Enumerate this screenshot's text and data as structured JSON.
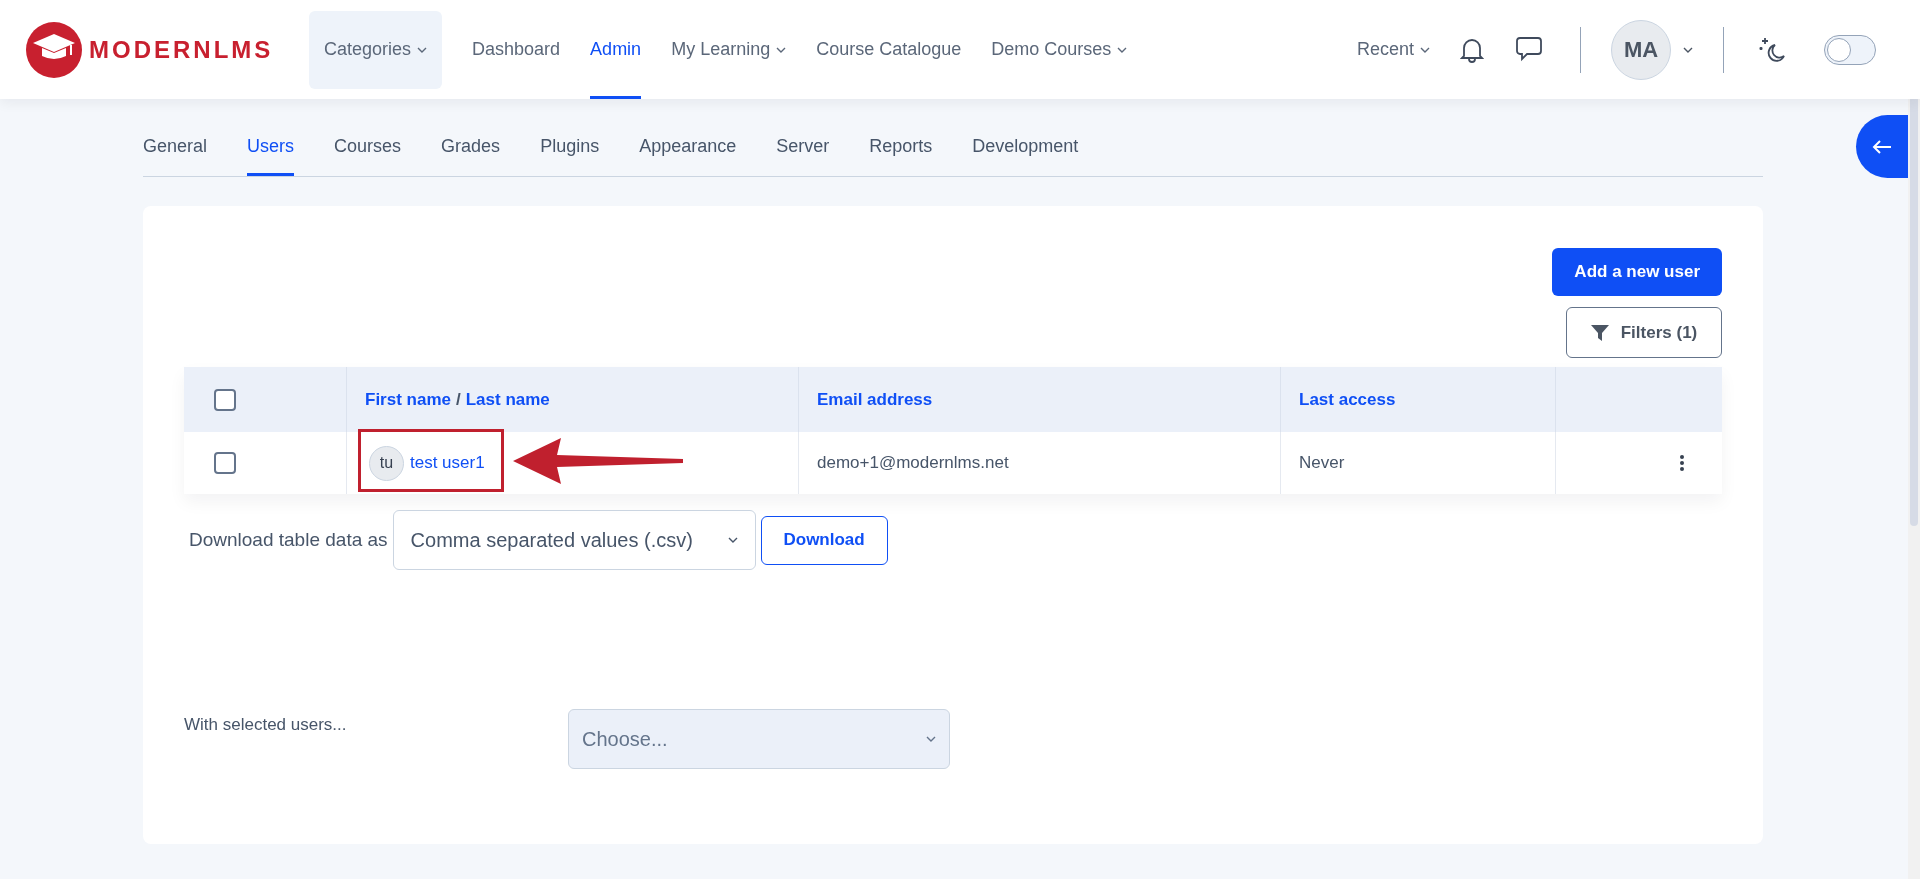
{
  "logo": {
    "wordmark": "MODERNLMS"
  },
  "nav": [
    {
      "label": "Categories",
      "dropdown": true,
      "selected": false,
      "boxed": true
    },
    {
      "label": "Dashboard",
      "dropdown": false,
      "selected": false,
      "boxed": false
    },
    {
      "label": "Admin",
      "dropdown": false,
      "selected": true,
      "boxed": false
    },
    {
      "label": "My Learning",
      "dropdown": true,
      "selected": false,
      "boxed": false
    },
    {
      "label": "Course Catalogue",
      "dropdown": false,
      "selected": false,
      "boxed": false
    },
    {
      "label": "Demo Courses",
      "dropdown": true,
      "selected": false,
      "boxed": false
    }
  ],
  "header_right": {
    "recent": "Recent",
    "avatar_initials": "MA",
    "dark_mode_on": false
  },
  "tabs": [
    {
      "label": "General",
      "selected": false
    },
    {
      "label": "Users",
      "selected": true
    },
    {
      "label": "Courses",
      "selected": false
    },
    {
      "label": "Grades",
      "selected": false
    },
    {
      "label": "Plugins",
      "selected": false
    },
    {
      "label": "Appearance",
      "selected": false
    },
    {
      "label": "Server",
      "selected": false
    },
    {
      "label": "Reports",
      "selected": false
    },
    {
      "label": "Development",
      "selected": false
    }
  ],
  "add_user_button": "Add a new user",
  "filters_button": "Filters (1)",
  "table": {
    "select_all_checked": false,
    "columns": [
      {
        "parts": [
          "First name",
          "Last name"
        ],
        "separator": "/"
      },
      {
        "parts": [
          "Email address"
        ]
      },
      {
        "parts": [
          "Last access"
        ]
      }
    ],
    "rows": [
      {
        "checked": false,
        "initials": "tu",
        "name": "test user1",
        "email": "demo+1@modernlms.net",
        "last_access": "Never"
      }
    ]
  },
  "download": {
    "label": "Download table data as",
    "format": "Comma separated values (.csv)",
    "button": "Download"
  },
  "bulk": {
    "label": "With selected users...",
    "placeholder": "Choose..."
  }
}
